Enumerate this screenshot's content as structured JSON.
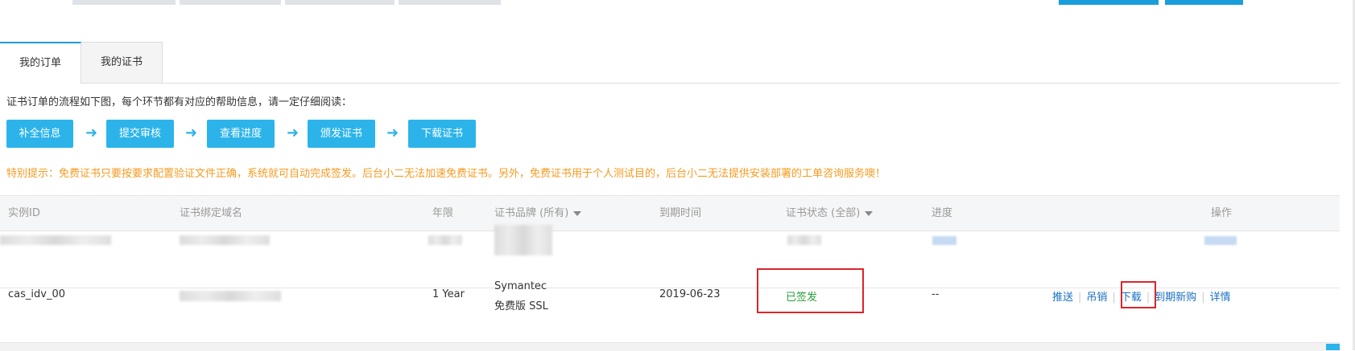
{
  "tabs": [
    {
      "label": "我的订单",
      "active": true
    },
    {
      "label": "我的证书",
      "active": false
    }
  ],
  "intro_text": "证书订单的流程如下图，每个环节都有对应的帮助信息，请一定仔细阅读：",
  "steps": [
    "补全信息",
    "提交审核",
    "查看进度",
    "颁发证书",
    "下载证书"
  ],
  "notice_text": "特别提示：免费证书只要按要求配置验证文件正确，系统就可自动完成签发。后台小二无法加速免费证书。另外，免费证书用于个人测试目的，后台小二无法提供安装部署的工单咨询服务噢！",
  "table": {
    "columns": [
      "实例ID",
      "证书绑定域名",
      "年限",
      "证书品牌 (所有)",
      "到期时间",
      "证书状态 (全部)",
      "进度",
      "操作"
    ],
    "rows": [
      {
        "instance_id": "cas_idv_00",
        "years": "1 Year",
        "brand_line1": "Symantec",
        "brand_line2": "免费版 SSL",
        "expiry": "2019-06-23",
        "status": "已签发",
        "progress": "--",
        "actions": [
          "推送",
          "吊销",
          "下载",
          "到期新购",
          "详情"
        ]
      }
    ]
  },
  "colors": {
    "accent": "#1a9edb",
    "step": "#2cb4ea",
    "notice": "#f59b22",
    "status_ok": "#2a9d3a",
    "link": "#1a6fc4",
    "highlight": "#d9262c"
  }
}
